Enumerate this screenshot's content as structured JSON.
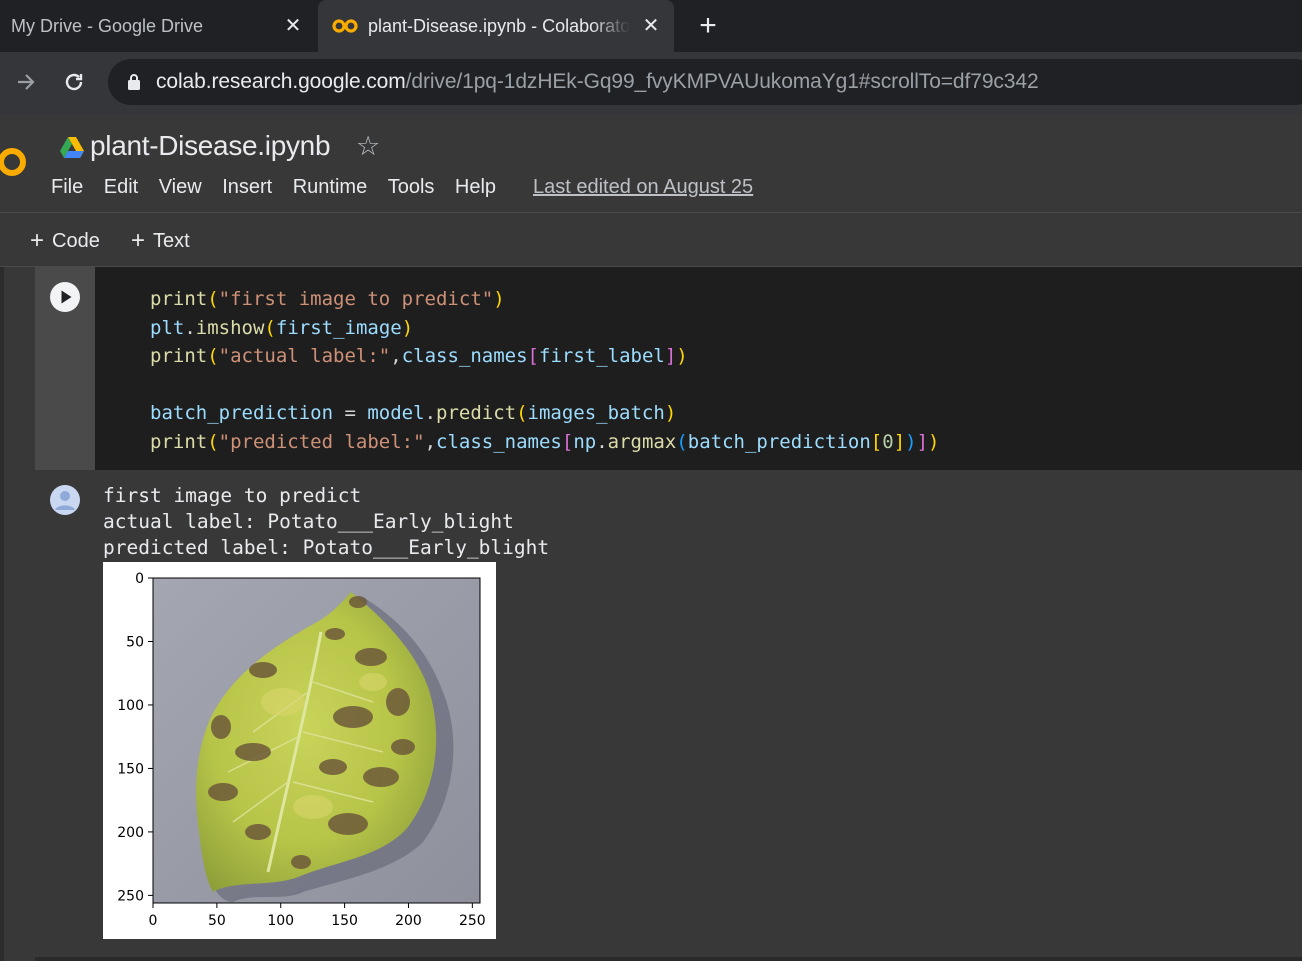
{
  "browser": {
    "tabs": [
      {
        "title": "My Drive - Google Drive",
        "active": false
      },
      {
        "title": "plant-Disease.ipynb - Colaboratory",
        "active": true
      }
    ],
    "new_tab_glyph": "+",
    "close_glyph": "✕",
    "url_host": "colab.research.google.com",
    "url_path": "/drive/1pq-1dzHEk-Gq99_fvyKMPVAUukomaYg1#scrollTo=df79c342"
  },
  "colab": {
    "notebook_title": "plant-Disease.ipynb",
    "star_glyph": "☆",
    "menu": [
      "File",
      "Edit",
      "View",
      "Insert",
      "Runtime",
      "Tools",
      "Help"
    ],
    "last_edited": "Last edited on August 25",
    "insert_code_label": "Code",
    "insert_text_label": "Text"
  },
  "cell": {
    "code_lines": [
      "print(\"first image to predict\")",
      "plt.imshow(first_image)",
      "print(\"actual label:\",class_names[first_label])",
      "",
      "batch_prediction = model.predict(images_batch)",
      "print(\"predicted label:\",class_names[np.argmax(batch_prediction[0])])"
    ],
    "output_lines": [
      "first image to predict",
      "actual label: Potato___Early_blight",
      "predicted label: Potato___Early_blight"
    ]
  },
  "chart_data": {
    "type": "image",
    "x_ticks": [
      0,
      50,
      100,
      150,
      200,
      250
    ],
    "y_ticks": [
      0,
      50,
      100,
      150,
      200,
      250
    ],
    "xlim": [
      0,
      256
    ],
    "ylim": [
      256,
      0
    ],
    "image_subject": "potato leaf with early blight lesions"
  },
  "colors": {
    "accent_orange": "#f9ab00",
    "editor_bg": "#1e1e1e",
    "page_bg": "#383838"
  }
}
